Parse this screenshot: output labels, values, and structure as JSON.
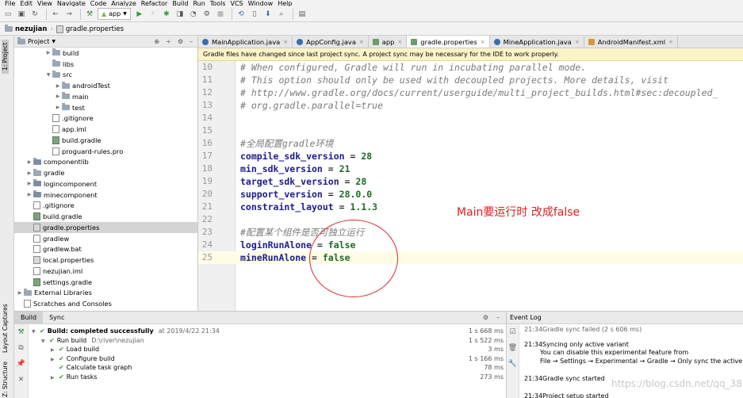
{
  "menu": [
    "File",
    "Edit",
    "View",
    "Navigate",
    "Code",
    "Analyze",
    "Refactor",
    "Build",
    "Run",
    "Tools",
    "VCS",
    "Window",
    "Help"
  ],
  "toolbar": {
    "run_config": "app"
  },
  "breadcrumb": [
    "nezujian",
    "gradle.properties"
  ],
  "side_tabs": {
    "project": "1: Project",
    "captures": "Layout Captures",
    "structure": "Z: Structure"
  },
  "project_panel": {
    "title": "Project",
    "items": [
      {
        "label": "build",
        "depth": 3,
        "type": "folder",
        "arrow": "▶"
      },
      {
        "label": "libs",
        "depth": 3,
        "type": "folder",
        "arrow": ""
      },
      {
        "label": "src",
        "depth": 3,
        "type": "folder",
        "arrow": "▼"
      },
      {
        "label": "androidTest",
        "depth": 4,
        "type": "folder",
        "arrow": "▶"
      },
      {
        "label": "main",
        "depth": 4,
        "type": "folder",
        "arrow": "▶"
      },
      {
        "label": "test",
        "depth": 4,
        "type": "folder",
        "arrow": "▶"
      },
      {
        "label": ".gitignore",
        "depth": 3,
        "type": "file",
        "arrow": ""
      },
      {
        "label": "app.iml",
        "depth": 3,
        "type": "file",
        "arrow": ""
      },
      {
        "label": "build.gradle",
        "depth": 3,
        "type": "gradle",
        "arrow": ""
      },
      {
        "label": "proguard-rules.pro",
        "depth": 3,
        "type": "file",
        "arrow": ""
      },
      {
        "label": "componentlib",
        "depth": 1,
        "type": "module",
        "arrow": "▶"
      },
      {
        "label": "gradle",
        "depth": 1,
        "type": "folder",
        "arrow": "▶"
      },
      {
        "label": "logincomponent",
        "depth": 1,
        "type": "module",
        "arrow": "▶"
      },
      {
        "label": "minecomponent",
        "depth": 1,
        "type": "module",
        "arrow": "▶"
      },
      {
        "label": ".gitignore",
        "depth": 1,
        "type": "file",
        "arrow": ""
      },
      {
        "label": "build.gradle",
        "depth": 1,
        "type": "gradle",
        "arrow": ""
      },
      {
        "label": "gradle.properties",
        "depth": 1,
        "type": "props",
        "arrow": "",
        "selected": true
      },
      {
        "label": "gradlew",
        "depth": 1,
        "type": "file",
        "arrow": ""
      },
      {
        "label": "gradlew.bat",
        "depth": 1,
        "type": "file",
        "arrow": ""
      },
      {
        "label": "local.properties",
        "depth": 1,
        "type": "props",
        "arrow": ""
      },
      {
        "label": "nezujian.iml",
        "depth": 1,
        "type": "file",
        "arrow": ""
      },
      {
        "label": "settings.gradle",
        "depth": 1,
        "type": "gradle",
        "arrow": ""
      },
      {
        "label": "External Libraries",
        "depth": 0,
        "type": "folder",
        "arrow": "▶"
      },
      {
        "label": "Scratches and Consoles",
        "depth": 0,
        "type": "file",
        "arrow": ""
      }
    ]
  },
  "editor_tabs": [
    {
      "label": "MainApplication.java",
      "icon": "c",
      "active": false
    },
    {
      "label": "AppConfig.java",
      "icon": "c",
      "active": false
    },
    {
      "label": "app",
      "icon": "g",
      "active": false
    },
    {
      "label": "gradle.properties",
      "icon": "g",
      "active": true
    },
    {
      "label": "MineApplication.java",
      "icon": "c",
      "active": false
    },
    {
      "label": "AndroidManifest.xml",
      "icon": "x",
      "active": false
    }
  ],
  "banner": "Gradle files have changed since last project sync. A project sync may be necessary for the IDE to work properly.",
  "code_lines": [
    {
      "n": "10",
      "kind": "comment",
      "text": "# When configured, Gradle will run in incubating parallel mode."
    },
    {
      "n": "11",
      "kind": "comment",
      "text": "# This option should only be used with decoupled projects. More details, visit"
    },
    {
      "n": "12",
      "kind": "comment",
      "text": "# http://www.gradle.org/docs/current/userguide/multi_project_builds.html#sec:decoupled_"
    },
    {
      "n": "13",
      "kind": "comment",
      "text": "# org.gradle.parallel=true"
    },
    {
      "n": "14",
      "kind": "blank",
      "text": ""
    },
    {
      "n": "15",
      "kind": "blank",
      "text": ""
    },
    {
      "n": "16",
      "kind": "comment",
      "text": "#全局配置gradle环境"
    },
    {
      "n": "17",
      "kind": "prop",
      "key": "compile_sdk_version",
      "value": "28"
    },
    {
      "n": "18",
      "kind": "prop",
      "key": "min_sdk_version",
      "value": "21"
    },
    {
      "n": "19",
      "kind": "prop",
      "key": "target_sdk_version",
      "value": "28"
    },
    {
      "n": "20",
      "kind": "prop",
      "key": "support_version",
      "value": "28.0.0"
    },
    {
      "n": "21",
      "kind": "prop",
      "key": "constraint_layout",
      "value": "1.1.3"
    },
    {
      "n": "22",
      "kind": "blank",
      "text": ""
    },
    {
      "n": "23",
      "kind": "comment",
      "text": "#配置某个组件是否可独立运行"
    },
    {
      "n": "24",
      "kind": "prop",
      "key": "loginRunAlone",
      "value": "false"
    },
    {
      "n": "25",
      "kind": "prop",
      "key": "mineRunAlone",
      "value": "false",
      "caret": true
    }
  ],
  "annotation": "Main要运行时   改成false",
  "build_panel": {
    "tabs": [
      "Build",
      "Sync"
    ],
    "rows": [
      {
        "indent": 0,
        "arrow": "▼",
        "label": "Build: completed successfully",
        "extra": "at 2019/4/22 21:34",
        "time": "1 s 668 ms",
        "bold": true
      },
      {
        "indent": 1,
        "arrow": "▼",
        "label": "Run build",
        "extra": "D:\\river\\nezujian",
        "time": "1 s 522 ms",
        "bold": false
      },
      {
        "indent": 2,
        "arrow": "▶",
        "label": "Load build",
        "extra": "",
        "time": "3 ms",
        "bold": false
      },
      {
        "indent": 2,
        "arrow": "▶",
        "label": "Configure build",
        "extra": "",
        "time": "1 s 166 ms",
        "bold": false
      },
      {
        "indent": 2,
        "arrow": "",
        "label": "Calculate task graph",
        "extra": "",
        "time": "78 ms",
        "bold": false
      },
      {
        "indent": 2,
        "arrow": "▶",
        "label": "Run tasks",
        "extra": "",
        "time": "273 ms",
        "bold": false
      }
    ]
  },
  "event_log": {
    "title": "Event Log",
    "lines": [
      "21:34Gradle sync failed (2 s 606 ms)",
      "21:34Syncing only active variant",
      "You can disable this experimental feature from",
      "File → Settings → Experimental → Gradle → Only sync the active v",
      "21:34Gradle sync started",
      "21:34Project setup started"
    ],
    "watermark": "https://blog.csdn.net/qq_38363256"
  }
}
